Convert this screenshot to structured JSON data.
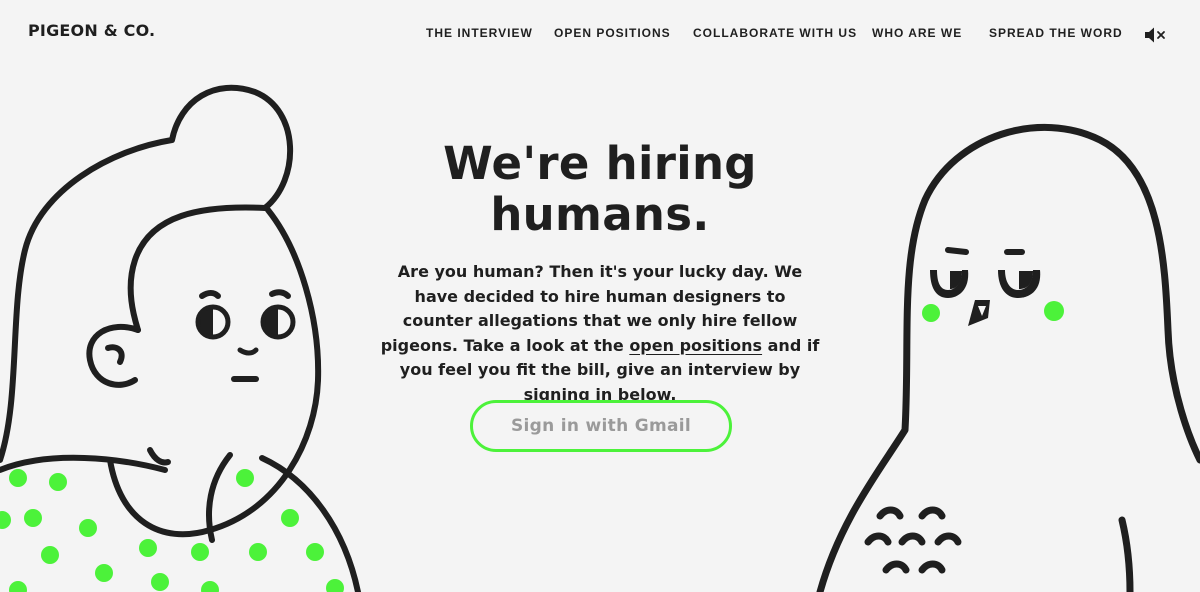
{
  "brand": {
    "logo_text": "PIGEON & CO."
  },
  "nav": {
    "items": [
      {
        "label": "THE INTERVIEW"
      },
      {
        "label": "OPEN POSITIONS"
      },
      {
        "label": "COLLABORATE WITH US"
      },
      {
        "label": "WHO ARE WE"
      },
      {
        "label": "SPREAD THE WORD"
      }
    ],
    "mute_icon": "speaker-muted-icon"
  },
  "hero": {
    "headline_line1": "We're hiring",
    "headline_line2": "humans.",
    "body_before_link": "Are you human? Then it's your lucky day. We have decided to hire human designers to counter allegations that we only hire fellow pigeons. Take a look at the ",
    "body_link": "open positions",
    "body_after_link": " and if you feel you fit the bill, give an interview by signing in below.",
    "cta_label": "Sign in with Gmail"
  },
  "illustrations": {
    "left": "human-illustration",
    "right": "pigeon-illustration"
  },
  "colors": {
    "background": "#f4f4f4",
    "ink": "#1f1f1f",
    "accent_green": "#4cf23a",
    "button_text": "#9a9a9a"
  }
}
